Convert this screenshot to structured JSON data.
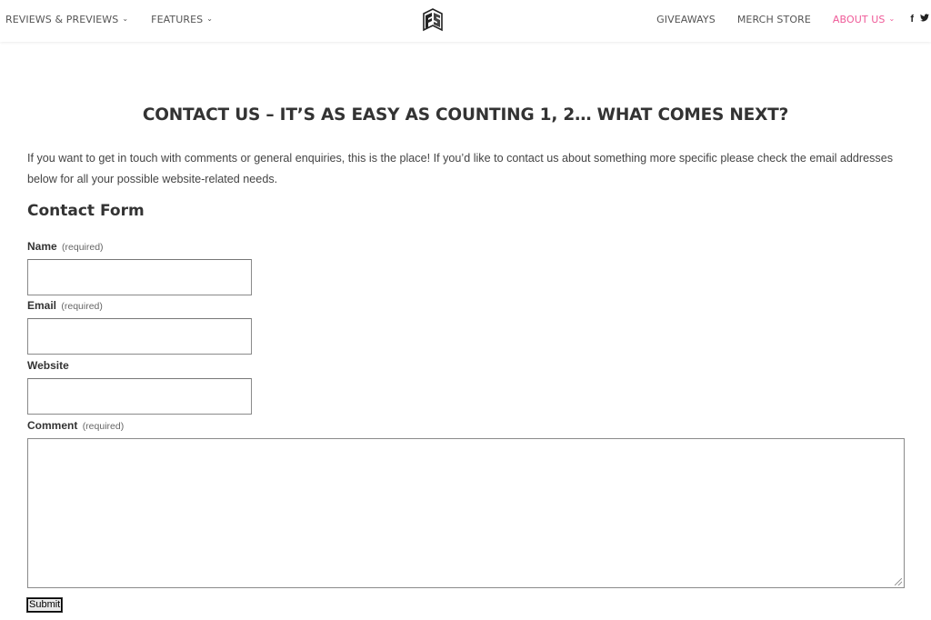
{
  "nav": {
    "left": [
      {
        "label": "REVIEWS & PREVIEWS",
        "has_dropdown": true
      },
      {
        "label": "FEATURES",
        "has_dropdown": true
      }
    ],
    "right": [
      {
        "label": "GIVEAWAYS",
        "has_dropdown": false
      },
      {
        "label": "MERCH STORE",
        "has_dropdown": false
      },
      {
        "label": "ABOUT US",
        "has_dropdown": true,
        "active": true
      }
    ],
    "chevron": "⌄",
    "social": [
      {
        "icon": "facebook-icon",
        "glyph": "f"
      },
      {
        "icon": "twitter-icon",
        "glyph": "🐦"
      }
    ],
    "active_color": "#ef5a98"
  },
  "logo": {
    "icon": "site-logo-icon"
  },
  "page": {
    "title": "CONTACT US – IT’S AS EASY AS COUNTING 1, 2… WHAT COMES NEXT?",
    "intro": "If you want to get in touch with comments or general enquiries, this is the place! If you’d like to contact us about something more specific please check the email addresses below for all your possible website-related needs."
  },
  "form": {
    "title": "Contact Form",
    "fields": {
      "name": {
        "label": "Name",
        "note": "(required)",
        "value": ""
      },
      "email": {
        "label": "Email",
        "note": "(required)",
        "value": ""
      },
      "website": {
        "label": "Website",
        "note": "",
        "value": ""
      },
      "comment": {
        "label": "Comment",
        "note": "(required)",
        "value": ""
      }
    },
    "submit_label": "Submit"
  }
}
